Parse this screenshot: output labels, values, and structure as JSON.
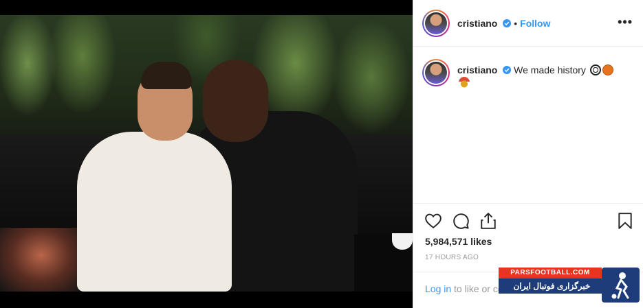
{
  "post": {
    "photo_alt": "Photo"
  },
  "header": {
    "username": "cristiano",
    "separator": "•",
    "follow_label": "Follow",
    "more_label": "•••"
  },
  "caption": {
    "username": "cristiano",
    "text": "We made history"
  },
  "stats": {
    "likes": "5,984,571 likes",
    "time": "17 HOURS AGO"
  },
  "login": {
    "link_label": "Log in",
    "rest_text": " to like or comment."
  },
  "watermark": {
    "top": "PARSFOOTBALL.COM",
    "bottom": "خبرگزاری فوتبال ایران"
  },
  "icons": {
    "verified": "verified-badge-icon",
    "like": "heart-icon",
    "comment": "comment-bubble-icon",
    "share": "share-icon",
    "save": "bookmark-icon"
  },
  "colors": {
    "link": "#3897f0",
    "text": "#262626",
    "muted": "#999999",
    "verified": "#3897f0"
  }
}
